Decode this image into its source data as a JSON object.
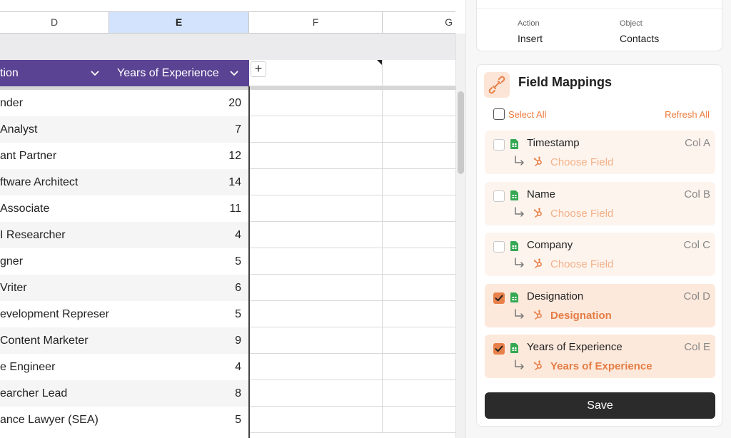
{
  "sheet": {
    "columns": [
      "D",
      "E",
      "F",
      "G"
    ],
    "selected_column": "E",
    "header_cells": [
      {
        "label": "tion"
      },
      {
        "label": "Years of Experience"
      }
    ],
    "add_column_label": "+",
    "rows": [
      {
        "d": "nder",
        "e": "20"
      },
      {
        "d": "Analyst",
        "e": "7"
      },
      {
        "d": "ant Partner",
        "e": "12"
      },
      {
        "d": "ftware Architect",
        "e": "14"
      },
      {
        "d": "Associate",
        "e": "11"
      },
      {
        "d": "I Researcher",
        "e": "4"
      },
      {
        "d": "gner",
        "e": "5"
      },
      {
        "d": "Vriter",
        "e": "6"
      },
      {
        "d": "evelopment Represen",
        "e": "5"
      },
      {
        "d": "Content Marketer",
        "e": "9"
      },
      {
        "d": "e Engineer",
        "e": "4"
      },
      {
        "d": "earcher Lead",
        "e": "8"
      },
      {
        "d": "ance Lawyer (SEA)",
        "e": "5"
      }
    ]
  },
  "panel": {
    "action_label": "Action",
    "action_value": "Insert",
    "object_label": "Object",
    "object_value": "Contacts",
    "field_mappings_title": "Field Mappings",
    "select_all_label": "Select All",
    "refresh_all_label": "Refresh All",
    "mappings": [
      {
        "field": "Timestamp",
        "column": "Col A",
        "target": "Choose Field",
        "checked": false
      },
      {
        "field": "Name",
        "column": "Col B",
        "target": "Choose Field",
        "checked": false
      },
      {
        "field": "Company",
        "column": "Col C",
        "target": "Choose Field",
        "checked": false
      },
      {
        "field": "Designation",
        "column": "Col D",
        "target": "Designation",
        "checked": true
      },
      {
        "field": "Years of Experience",
        "column": "Col E",
        "target": "Years of Experience",
        "checked": true
      }
    ],
    "save_label": "Save",
    "colors": {
      "accent": "#ee7b3d",
      "header_purple": "#5b4394",
      "selected_col": "#d3e3fd",
      "sheet_green": "#34a853"
    }
  }
}
